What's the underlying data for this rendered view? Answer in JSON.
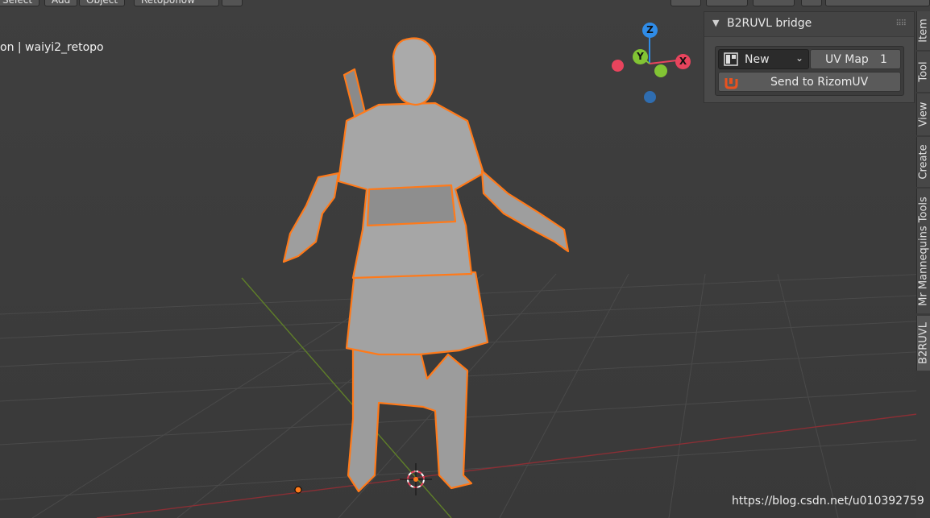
{
  "header": {
    "menu": [
      "Select",
      "Add",
      "Object"
    ],
    "mode_dropdown": "Retopoflow"
  },
  "viewport": {
    "title": "on | waiyi2_retopo"
  },
  "gizmo": {
    "z_label": "Z",
    "y_label": "Y",
    "x_label": "X",
    "colors": {
      "x": "#e8445d",
      "y": "#82c434",
      "z": "#2f8ce8"
    }
  },
  "panel": {
    "title": "B2RUVL bridge",
    "uv_select_value": "New",
    "uv_map_label": "UV Map",
    "uv_map_count": "1",
    "send_button": "Send to RizomUV"
  },
  "sidebar_tabs": [
    "Item",
    "Tool",
    "View",
    "Create",
    "Mr Mannequins Tools",
    "B2RUVL"
  ],
  "colors": {
    "selection_outline": "#ff7a1a",
    "background": "#3d3d3d",
    "floor_x_axis": "#8a2f35",
    "floor_y_axis": "#5f7f29"
  },
  "watermark": "https://blog.csdn.net/u010392759"
}
